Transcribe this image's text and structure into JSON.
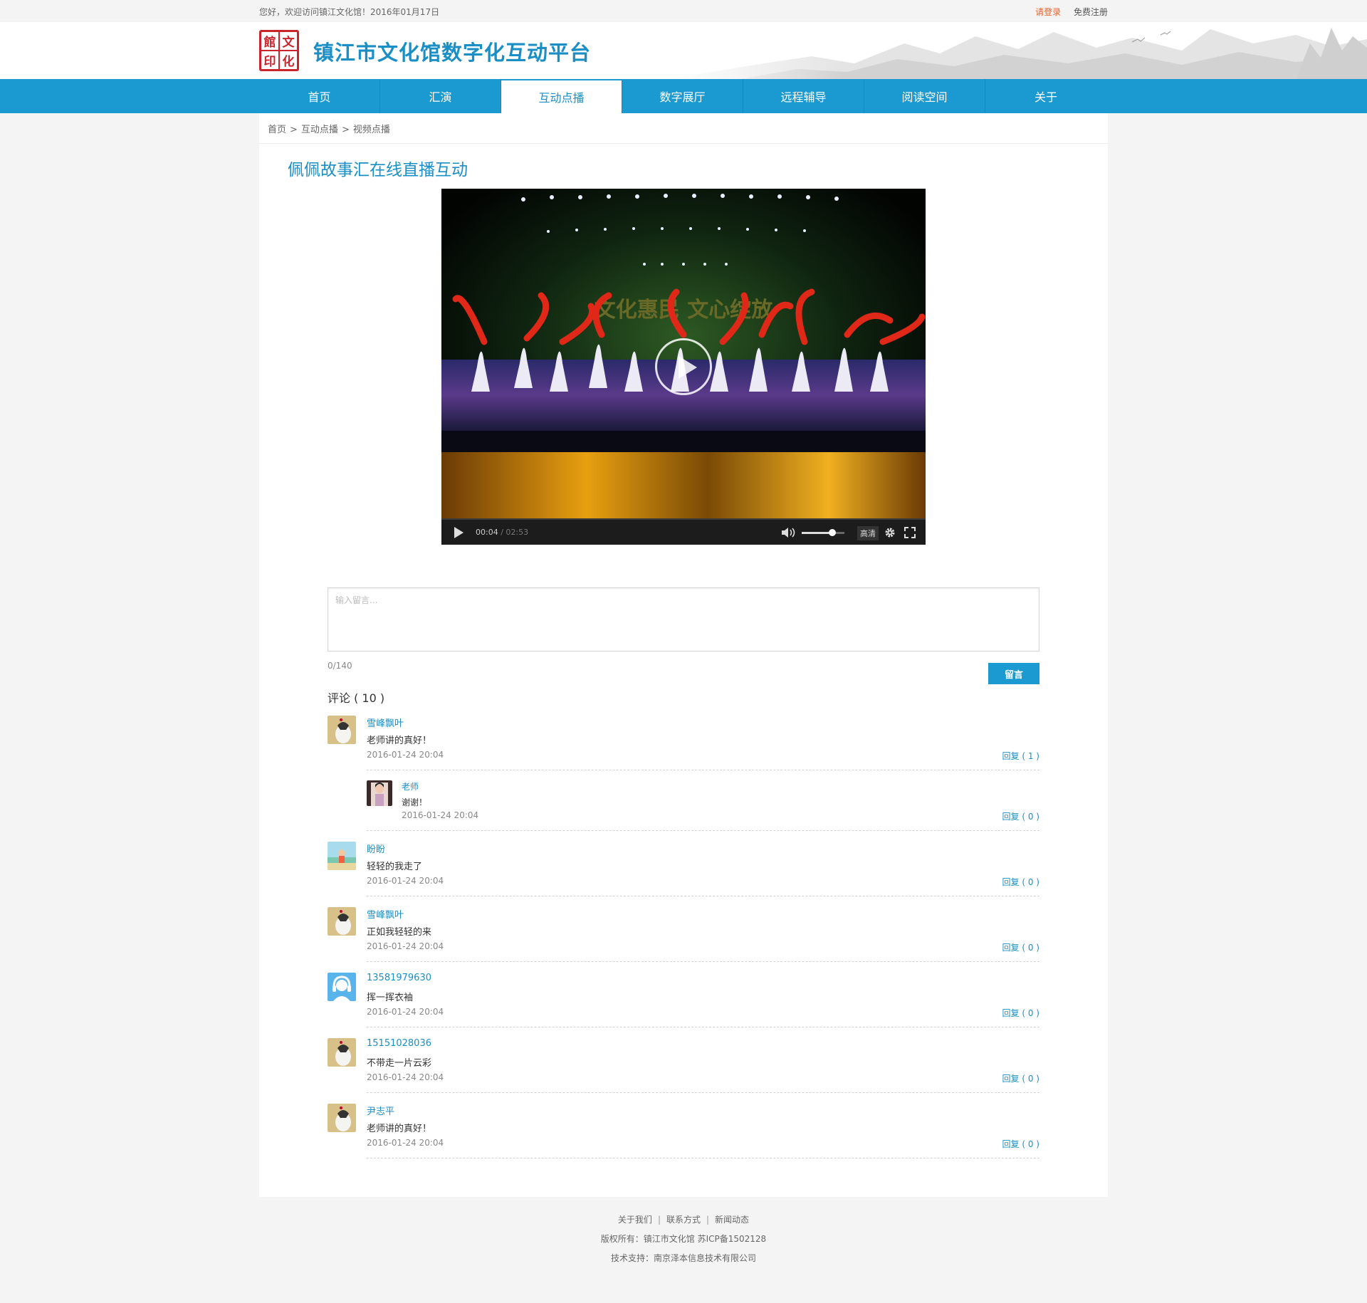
{
  "topbar": {
    "welcome": "您好，欢迎访问镇江文化馆！2016年01月17日",
    "login": "请登录",
    "register": "免费注册"
  },
  "header": {
    "logo_chars": [
      "館",
      "文",
      "印",
      "化"
    ],
    "title": "镇江市文化馆数字化互动平台"
  },
  "nav": {
    "items": [
      "首页",
      "汇演",
      "互动点播",
      "数字展厅",
      "远程辅导",
      "阅读空间",
      "关于"
    ],
    "active_index": 2
  },
  "breadcrumb": {
    "items": [
      "首页",
      "互动点播",
      "视频点播"
    ],
    "separator": ">"
  },
  "page_title": "佩佩故事汇在线直播互动",
  "video": {
    "current_time": "00:04",
    "duration": "02:53",
    "time_sep": "/",
    "volume": 0.72,
    "quality": "高清",
    "stage_banner": "文化惠民 文心绽放"
  },
  "comment_form": {
    "placeholder": "输入留言...",
    "counter": "0/140",
    "submit": "留言"
  },
  "comments_header": "评论 ( 10 )",
  "comments": [
    {
      "name": "雪峰飘叶",
      "text": "老师讲的真好！",
      "date": "2016-01-24 20:04",
      "reply": "回复 ( 1 )",
      "avatar": "default-avatar"
    },
    {
      "name": "老师",
      "text": "谢谢！",
      "date": "2016-01-24 20:04",
      "reply": "回复 ( 0 )",
      "avatar": "teacher-avatar"
    },
    {
      "name": "盼盼",
      "text": "轻轻的我走了",
      "date": "2016-01-24 20:04",
      "reply": "回复 ( 0 )",
      "avatar": "beach-avatar"
    },
    {
      "name": "雪峰飘叶",
      "text": "正如我轻轻的来",
      "date": "2016-01-24 20:04",
      "reply": "回复 ( 0 )",
      "avatar": "default-avatar"
    },
    {
      "name": "13581979630",
      "text": "挥一挥衣袖",
      "date": "2016-01-24 20:04",
      "reply": "回复 ( 0 )",
      "avatar": "headset-avatar"
    },
    {
      "name": "15151028036",
      "text": "不带走一片云彩",
      "date": "2016-01-24 20:04",
      "reply": "回复 ( 0 )",
      "avatar": "default-avatar"
    },
    {
      "name": "尹志平",
      "text": "老师讲的真好！",
      "date": "2016-01-24 20:04",
      "reply": "回复 ( 0 )",
      "avatar": "default-avatar"
    }
  ],
  "footer": {
    "links": [
      "关于我们",
      "联系方式",
      "新闻动态"
    ],
    "link_sep": "|",
    "copyright": "版权所有：镇江市文化馆  苏ICP备1502128",
    "support": "技术支持：南京泽本信息技术有限公司"
  },
  "colors": {
    "brand_blue": "#1a9ad0",
    "title_blue": "#1a8fc5",
    "login_orange": "#e8632a",
    "logo_red": "#c8252c"
  }
}
